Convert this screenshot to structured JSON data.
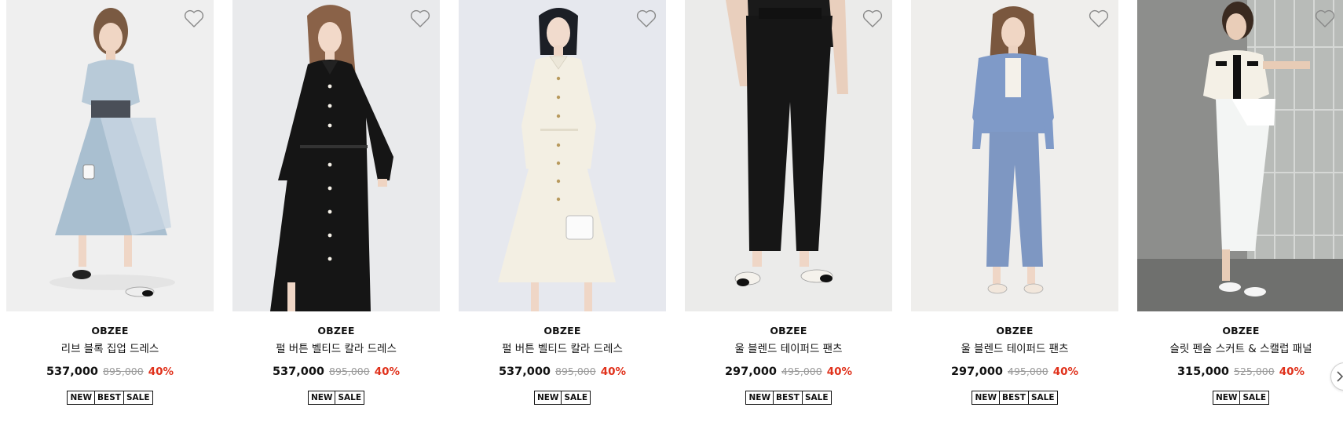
{
  "colors": {
    "discount": "#e0311b",
    "original_price": "#999999",
    "text": "#111111"
  },
  "products": [
    {
      "brand": "OBZEE",
      "name": "리브 블록 집업 드레스",
      "price": "537,000",
      "original_price": "895,000",
      "discount": "40%",
      "badges": [
        "NEW",
        "BEST",
        "SALE"
      ],
      "wish_icon": "heart-outline-icon",
      "image": "light-blue-dress-model"
    },
    {
      "brand": "OBZEE",
      "name": "펄 버튼 벨티드 칼라 드레스",
      "price": "537,000",
      "original_price": "895,000",
      "discount": "40%",
      "badges": [
        "NEW",
        "SALE"
      ],
      "wish_icon": "heart-outline-icon",
      "image": "black-dress-model"
    },
    {
      "brand": "OBZEE",
      "name": "펄 버튼 벨티드 칼라 드레스",
      "price": "537,000",
      "original_price": "895,000",
      "discount": "40%",
      "badges": [
        "NEW",
        "SALE"
      ],
      "wish_icon": "heart-outline-icon",
      "image": "ivory-dress-model"
    },
    {
      "brand": "OBZEE",
      "name": "울 블렌드 테이퍼드 팬츠",
      "price": "297,000",
      "original_price": "495,000",
      "discount": "40%",
      "badges": [
        "NEW",
        "BEST",
        "SALE"
      ],
      "wish_icon": "heart-outline-icon",
      "image": "black-pants-model"
    },
    {
      "brand": "OBZEE",
      "name": "울 블렌드 테이퍼드 팬츠",
      "price": "297,000",
      "original_price": "495,000",
      "discount": "40%",
      "badges": [
        "NEW",
        "BEST",
        "SALE"
      ],
      "wish_icon": "heart-outline-icon",
      "image": "blue-pants-model"
    },
    {
      "brand": "OBZEE",
      "name": "슬릿 펜슬 스커트 & 스캘럽 패널",
      "price": "315,000",
      "original_price": "525,000",
      "discount": "40%",
      "badges": [
        "NEW",
        "SALE"
      ],
      "wish_icon": "heart-outline-icon",
      "image": "white-skirt-model"
    }
  ],
  "carousel": {
    "next_icon": "chevron-right-icon"
  }
}
